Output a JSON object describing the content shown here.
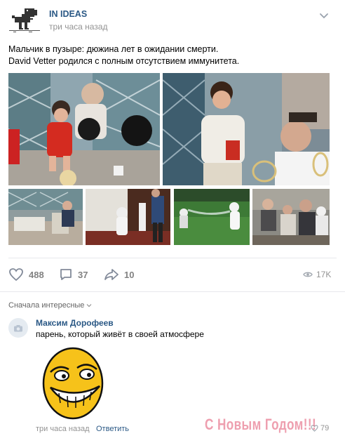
{
  "post": {
    "author": "IN IDEAS",
    "time": "три часа назад",
    "text_line1": "Мальчик в пузыре: дюжина лет в ожидании смерти.",
    "text_line2": "David Vetter родился с полным отсутствием иммунитета.",
    "photos": [
      {
        "name": "photo-child-in-bubble"
      },
      {
        "name": "photo-boy-with-doctor"
      },
      {
        "name": "photo-hospital-room"
      },
      {
        "name": "photo-boy-in-spacesuit"
      },
      {
        "name": "photo-spacesuit-on-grass"
      },
      {
        "name": "photo-family-with-boy"
      }
    ]
  },
  "actions": {
    "likes": "488",
    "comments": "37",
    "shares": "10",
    "views": "17K"
  },
  "comments_section": {
    "sort_label": "Сначала интересные"
  },
  "comment": {
    "author": "Максим Дорофеев",
    "text": "парень, который живёт в своей атмосфере",
    "time": "три часа назад",
    "reply_label": "Ответить",
    "likes": "79"
  },
  "watermark": "С Новым Годом!!!",
  "icons": {
    "logo": "dinosaur-logo-icon",
    "menu": "chevron-down-icon",
    "like": "heart-icon",
    "comment": "comment-icon",
    "share": "share-arrow-icon",
    "views": "eye-icon",
    "camera": "camera-icon"
  },
  "colors": {
    "link": "#2a5885",
    "muted": "#939393",
    "action": "#828282"
  }
}
